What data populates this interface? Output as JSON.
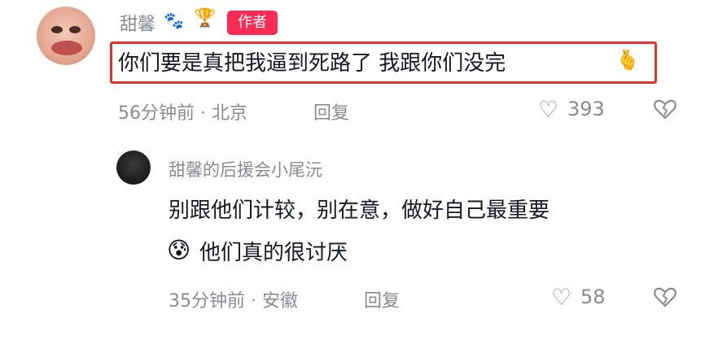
{
  "comment": {
    "username": "甜馨",
    "author_badge": "作者",
    "text": "你们要是真把我逼到死路了 我跟你们没完",
    "emoji": "🫰",
    "time": "56分钟前",
    "location": "北京",
    "reply_label": "回复",
    "likes": "393",
    "paw_icon": "🐾",
    "trophy_icon": "🏆"
  },
  "reply": {
    "username": "甜馨的后援会小尾沅",
    "text_line1": "别跟他们计较，别在意，做好自己最重要",
    "emoji": "😰",
    "text_line2": "他们真的很讨厌",
    "time": "35分钟前",
    "location": "安徽",
    "reply_label": "回复",
    "likes": "58"
  }
}
